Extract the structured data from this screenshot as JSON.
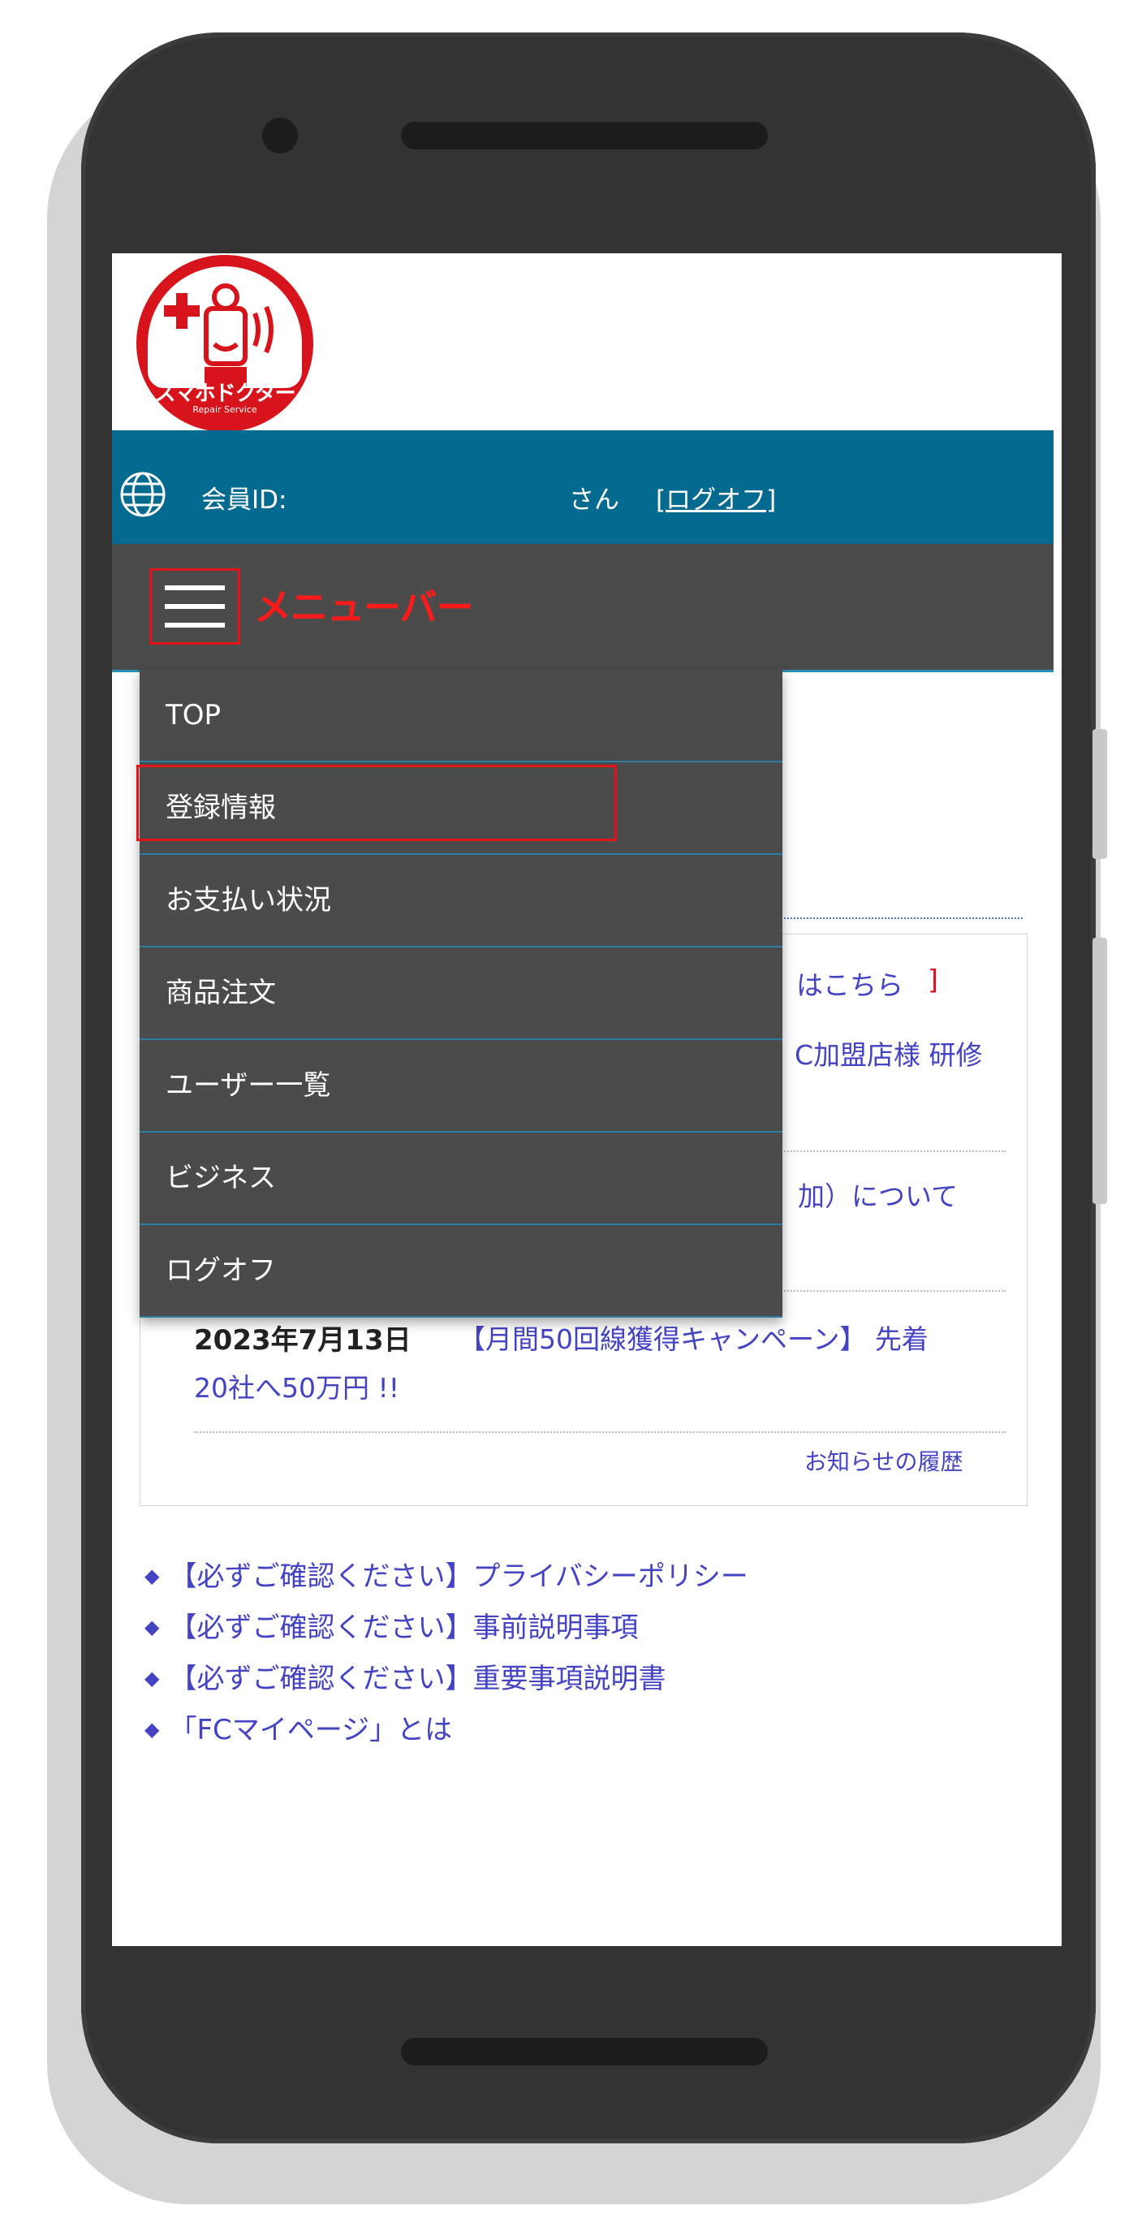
{
  "header": {
    "logo_text": "スマホドクター",
    "logo_subtext": "Repair Service"
  },
  "member_bar": {
    "member_label": "会員ID:",
    "san": "さん",
    "logout_link": "[ログオフ]",
    "globe_icon": "globe-icon"
  },
  "menu_bar": {
    "hamburger_icon": "hamburger-menu-icon",
    "annotation": "メニューバー"
  },
  "dropdown": {
    "items": [
      {
        "label": "TOP"
      },
      {
        "label": "登録情報"
      },
      {
        "label": "お支払い状況"
      },
      {
        "label": "商品注文"
      },
      {
        "label": "ユーザー一覧"
      },
      {
        "label": "ビジネス"
      },
      {
        "label": "ログオフ"
      }
    ]
  },
  "news": {
    "partial_1": "はこちら",
    "partial_1_bracket": "]",
    "partial_2": "C加盟店様 研修",
    "partial_3": "加）について",
    "item_date": "2023年7月13日",
    "item_title_line1": "【月間50回線獲得キャンペーン】 先着",
    "item_title_line2": "20社へ50万円 !!",
    "history_link": "お知らせの履歴"
  },
  "links": [
    {
      "label": "【必ずご確認ください】プライバシーポリシー"
    },
    {
      "label": "【必ずご確認ください】事前説明事項"
    },
    {
      "label": "【必ずご確認ください】重要事項説明書"
    },
    {
      "label": "「FCマイページ」とは"
    }
  ],
  "colors": {
    "member_bar": "#046a90",
    "menu_bar": "#4b4b4b",
    "highlight": "#e0151b",
    "link": "#4343c4"
  }
}
